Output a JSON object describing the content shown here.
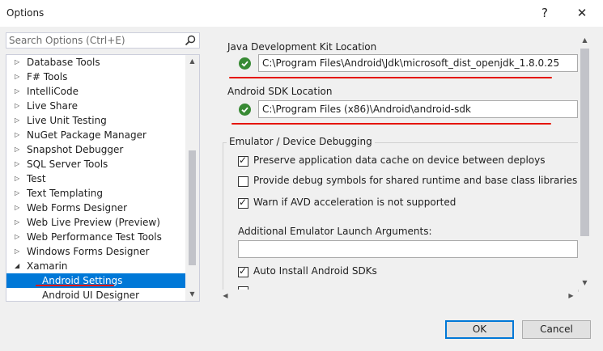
{
  "window": {
    "title": "Options",
    "help_glyph": "?",
    "close_glyph": "✕"
  },
  "search": {
    "placeholder": "Search Options (Ctrl+E)"
  },
  "tree": {
    "items": [
      {
        "label": "Database Tools",
        "expander": "▷"
      },
      {
        "label": "F# Tools",
        "expander": "▷"
      },
      {
        "label": "IntelliCode",
        "expander": "▷"
      },
      {
        "label": "Live Share",
        "expander": "▷"
      },
      {
        "label": "Live Unit Testing",
        "expander": "▷"
      },
      {
        "label": "NuGet Package Manager",
        "expander": "▷"
      },
      {
        "label": "Snapshot Debugger",
        "expander": "▷"
      },
      {
        "label": "SQL Server Tools",
        "expander": "▷"
      },
      {
        "label": "Test",
        "expander": "▷"
      },
      {
        "label": "Text Templating",
        "expander": "▷"
      },
      {
        "label": "Web Forms Designer",
        "expander": "▷"
      },
      {
        "label": "Web Live Preview (Preview)",
        "expander": "▷"
      },
      {
        "label": "Web Performance Test Tools",
        "expander": "▷"
      },
      {
        "label": "Windows Forms Designer",
        "expander": "▷"
      },
      {
        "label": "Xamarin",
        "expander": "◢"
      },
      {
        "label": "Android Settings",
        "expander": ""
      },
      {
        "label": "Android UI Designer",
        "expander": ""
      }
    ],
    "selected": "Android Settings"
  },
  "settings": {
    "jdk_label": "Java Development Kit Location",
    "jdk_path": "C:\\Program Files\\Android\\Jdk\\microsoft_dist_openjdk_1.8.0.25",
    "sdk_label": "Android SDK Location",
    "sdk_path": "C:\\Program Files (x86)\\Android\\android-sdk",
    "emulator_group": "Emulator / Device Debugging",
    "options": [
      {
        "label": "Preserve application data cache on device between deploys",
        "checked": true
      },
      {
        "label": "Provide debug symbols for shared runtime and base class libraries",
        "checked": false
      },
      {
        "label": "Warn if AVD acceleration is not supported",
        "checked": true
      }
    ],
    "emulator_args_label": "Additional Emulator Launch Arguments:",
    "emulator_args_value": "",
    "auto_install_label": "Auto Install Android SDKs",
    "auto_install_checked": true
  },
  "buttons": {
    "ok": "OK",
    "cancel": "Cancel"
  },
  "colors": {
    "accent": "#0078d7",
    "success": "#388a34",
    "annotation": "#e51400"
  }
}
